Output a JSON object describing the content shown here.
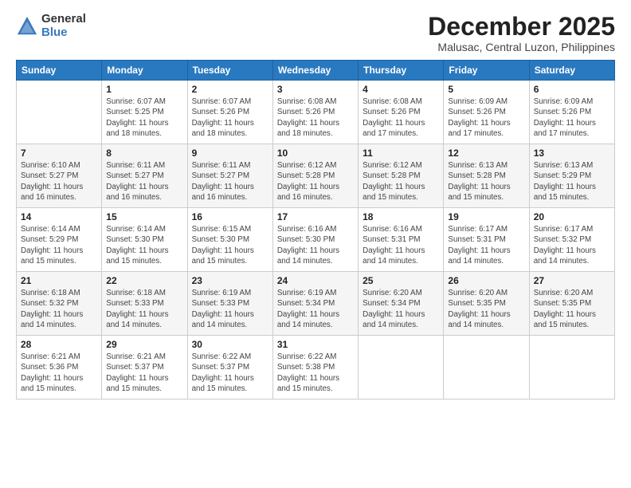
{
  "logo": {
    "general": "General",
    "blue": "Blue"
  },
  "title": "December 2025",
  "location": "Malusac, Central Luzon, Philippines",
  "days_header": [
    "Sunday",
    "Monday",
    "Tuesday",
    "Wednesday",
    "Thursday",
    "Friday",
    "Saturday"
  ],
  "weeks": [
    [
      {
        "num": "",
        "info": ""
      },
      {
        "num": "1",
        "info": "Sunrise: 6:07 AM\nSunset: 5:25 PM\nDaylight: 11 hours\nand 18 minutes."
      },
      {
        "num": "2",
        "info": "Sunrise: 6:07 AM\nSunset: 5:26 PM\nDaylight: 11 hours\nand 18 minutes."
      },
      {
        "num": "3",
        "info": "Sunrise: 6:08 AM\nSunset: 5:26 PM\nDaylight: 11 hours\nand 18 minutes."
      },
      {
        "num": "4",
        "info": "Sunrise: 6:08 AM\nSunset: 5:26 PM\nDaylight: 11 hours\nand 17 minutes."
      },
      {
        "num": "5",
        "info": "Sunrise: 6:09 AM\nSunset: 5:26 PM\nDaylight: 11 hours\nand 17 minutes."
      },
      {
        "num": "6",
        "info": "Sunrise: 6:09 AM\nSunset: 5:26 PM\nDaylight: 11 hours\nand 17 minutes."
      }
    ],
    [
      {
        "num": "7",
        "info": "Sunrise: 6:10 AM\nSunset: 5:27 PM\nDaylight: 11 hours\nand 16 minutes."
      },
      {
        "num": "8",
        "info": "Sunrise: 6:11 AM\nSunset: 5:27 PM\nDaylight: 11 hours\nand 16 minutes."
      },
      {
        "num": "9",
        "info": "Sunrise: 6:11 AM\nSunset: 5:27 PM\nDaylight: 11 hours\nand 16 minutes."
      },
      {
        "num": "10",
        "info": "Sunrise: 6:12 AM\nSunset: 5:28 PM\nDaylight: 11 hours\nand 16 minutes."
      },
      {
        "num": "11",
        "info": "Sunrise: 6:12 AM\nSunset: 5:28 PM\nDaylight: 11 hours\nand 15 minutes."
      },
      {
        "num": "12",
        "info": "Sunrise: 6:13 AM\nSunset: 5:28 PM\nDaylight: 11 hours\nand 15 minutes."
      },
      {
        "num": "13",
        "info": "Sunrise: 6:13 AM\nSunset: 5:29 PM\nDaylight: 11 hours\nand 15 minutes."
      }
    ],
    [
      {
        "num": "14",
        "info": "Sunrise: 6:14 AM\nSunset: 5:29 PM\nDaylight: 11 hours\nand 15 minutes."
      },
      {
        "num": "15",
        "info": "Sunrise: 6:14 AM\nSunset: 5:30 PM\nDaylight: 11 hours\nand 15 minutes."
      },
      {
        "num": "16",
        "info": "Sunrise: 6:15 AM\nSunset: 5:30 PM\nDaylight: 11 hours\nand 15 minutes."
      },
      {
        "num": "17",
        "info": "Sunrise: 6:16 AM\nSunset: 5:30 PM\nDaylight: 11 hours\nand 14 minutes."
      },
      {
        "num": "18",
        "info": "Sunrise: 6:16 AM\nSunset: 5:31 PM\nDaylight: 11 hours\nand 14 minutes."
      },
      {
        "num": "19",
        "info": "Sunrise: 6:17 AM\nSunset: 5:31 PM\nDaylight: 11 hours\nand 14 minutes."
      },
      {
        "num": "20",
        "info": "Sunrise: 6:17 AM\nSunset: 5:32 PM\nDaylight: 11 hours\nand 14 minutes."
      }
    ],
    [
      {
        "num": "21",
        "info": "Sunrise: 6:18 AM\nSunset: 5:32 PM\nDaylight: 11 hours\nand 14 minutes."
      },
      {
        "num": "22",
        "info": "Sunrise: 6:18 AM\nSunset: 5:33 PM\nDaylight: 11 hours\nand 14 minutes."
      },
      {
        "num": "23",
        "info": "Sunrise: 6:19 AM\nSunset: 5:33 PM\nDaylight: 11 hours\nand 14 minutes."
      },
      {
        "num": "24",
        "info": "Sunrise: 6:19 AM\nSunset: 5:34 PM\nDaylight: 11 hours\nand 14 minutes."
      },
      {
        "num": "25",
        "info": "Sunrise: 6:20 AM\nSunset: 5:34 PM\nDaylight: 11 hours\nand 14 minutes."
      },
      {
        "num": "26",
        "info": "Sunrise: 6:20 AM\nSunset: 5:35 PM\nDaylight: 11 hours\nand 14 minutes."
      },
      {
        "num": "27",
        "info": "Sunrise: 6:20 AM\nSunset: 5:35 PM\nDaylight: 11 hours\nand 15 minutes."
      }
    ],
    [
      {
        "num": "28",
        "info": "Sunrise: 6:21 AM\nSunset: 5:36 PM\nDaylight: 11 hours\nand 15 minutes."
      },
      {
        "num": "29",
        "info": "Sunrise: 6:21 AM\nSunset: 5:37 PM\nDaylight: 11 hours\nand 15 minutes."
      },
      {
        "num": "30",
        "info": "Sunrise: 6:22 AM\nSunset: 5:37 PM\nDaylight: 11 hours\nand 15 minutes."
      },
      {
        "num": "31",
        "info": "Sunrise: 6:22 AM\nSunset: 5:38 PM\nDaylight: 11 hours\nand 15 minutes."
      },
      {
        "num": "",
        "info": ""
      },
      {
        "num": "",
        "info": ""
      },
      {
        "num": "",
        "info": ""
      }
    ]
  ]
}
